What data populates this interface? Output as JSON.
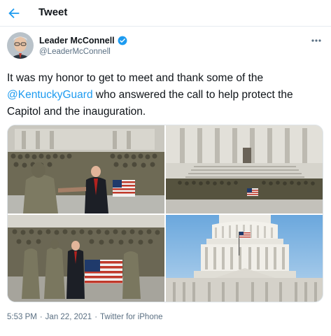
{
  "header": {
    "title": "Tweet",
    "back_icon": "arrow-left-icon"
  },
  "author": {
    "display_name": "Leader McConnell",
    "handle": "@LeaderMcConnell",
    "verified": true
  },
  "tweet": {
    "text_before": "It was my honor to get to meet and thank some of the ",
    "mention": "@KentuckyGuard",
    "text_after": " who answered the call to help protect the Capitol and the inauguration."
  },
  "meta": {
    "time": "5:53 PM",
    "separator": "·",
    "date": "Jan 22, 2021",
    "source": "Twitter for iPhone"
  },
  "colors": {
    "accent": "#1d9bf0",
    "muted": "#5b7083",
    "text": "#0f1419",
    "border": "#e6ecf0"
  }
}
